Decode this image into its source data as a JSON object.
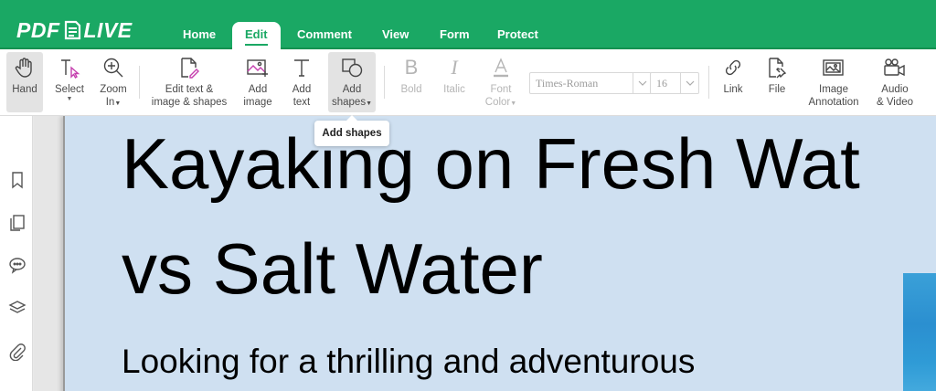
{
  "app": {
    "logo_text_left": "PDF",
    "logo_text_right": "LIVE"
  },
  "nav": {
    "tabs": [
      {
        "label": "Home"
      },
      {
        "label": "Edit"
      },
      {
        "label": "Comment"
      },
      {
        "label": "View"
      },
      {
        "label": "Form"
      },
      {
        "label": "Protect"
      }
    ],
    "active": "Edit"
  },
  "toolbar": {
    "hand": {
      "label": "Hand"
    },
    "select": {
      "label": "Select"
    },
    "zoom": {
      "line1": "Zoom",
      "line2": "In"
    },
    "edit_text": {
      "line1": "Edit text &",
      "line2": "image & shapes"
    },
    "add_image": {
      "line1": "Add",
      "line2": "image"
    },
    "add_text": {
      "line1": "Add",
      "line2": "text"
    },
    "add_shapes": {
      "line1": "Add",
      "line2": "shapes"
    },
    "bold": {
      "label": "Bold"
    },
    "italic": {
      "label": "Italic"
    },
    "font_color": {
      "line1": "Font",
      "line2": "Color"
    },
    "font_select": {
      "value": "Times-Roman"
    },
    "size_select": {
      "value": "16"
    },
    "link": {
      "label": "Link"
    },
    "file": {
      "label": "File"
    },
    "image_annotation": {
      "line1": "Image",
      "line2": "Annotation"
    },
    "audio_video": {
      "line1": "Audio",
      "line2": "& Video"
    }
  },
  "tooltip": {
    "text": "Add shapes"
  },
  "document": {
    "title_line1": "Kayaking on Fresh Wat",
    "title_line2": "vs Salt Water",
    "subtitle": "Looking for a thrilling and adventurous"
  },
  "colors": {
    "brand": "#1aa864",
    "page_bg": "#cfe0f1"
  },
  "sidebar_icons": [
    "bookmark-icon",
    "pages-icon",
    "comments-icon",
    "layers-icon",
    "attachment-icon"
  ]
}
